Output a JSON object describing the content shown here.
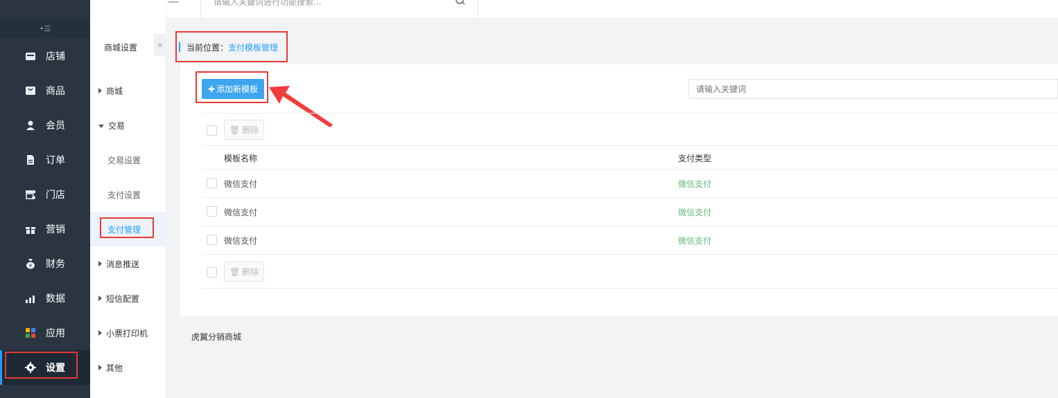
{
  "topbar": {
    "search_placeholder": "请输入关键词进行功能搜索..."
  },
  "sidebar": {
    "collapse_icon": "menu-collapse-icon",
    "items": [
      {
        "label": "店铺",
        "icon": "store-icon"
      },
      {
        "label": "商品",
        "icon": "goods-icon"
      },
      {
        "label": "会员",
        "icon": "member-icon"
      },
      {
        "label": "订单",
        "icon": "order-icon"
      },
      {
        "label": "门店",
        "icon": "shop-icon"
      },
      {
        "label": "营销",
        "icon": "gift-icon"
      },
      {
        "label": "财务",
        "icon": "money-bag-icon"
      },
      {
        "label": "数据",
        "icon": "chart-icon"
      },
      {
        "label": "应用",
        "icon": "apps-icon"
      },
      {
        "label": "设置",
        "icon": "gear-icon"
      }
    ]
  },
  "subnav": {
    "title": "商城设置",
    "toggle": "«",
    "items": {
      "mall": "商城",
      "trade": "交易",
      "trade_settings": "交易设置",
      "pay_settings": "支付设置",
      "pay_manage": "支付管理",
      "message_push": "消息推送",
      "sms_config": "短信配置",
      "receipt_printer": "小票打印机",
      "other": "其他"
    }
  },
  "breadcrumb": {
    "prefix": "当前位置：",
    "current": "支付模板管理"
  },
  "toolbar": {
    "add_label": "添加新模板",
    "keyword_placeholder": "请输入关键词",
    "delete_label": "删除"
  },
  "table": {
    "headers": [
      "模板名称",
      "支付类型"
    ],
    "rows": [
      {
        "name": "微信支付",
        "type": "微信支付"
      },
      {
        "name": "微信支付",
        "type": "微信支付"
      },
      {
        "name": "微信支付",
        "type": "微信支付"
      }
    ]
  },
  "footer": {
    "text": "虎翼分销商城"
  },
  "colors": {
    "accent": "#1e9fff",
    "button": "#3ea6ef",
    "success": "#5fb878",
    "highlight": "#e53935",
    "sidebar_bg": "#2b3542"
  }
}
